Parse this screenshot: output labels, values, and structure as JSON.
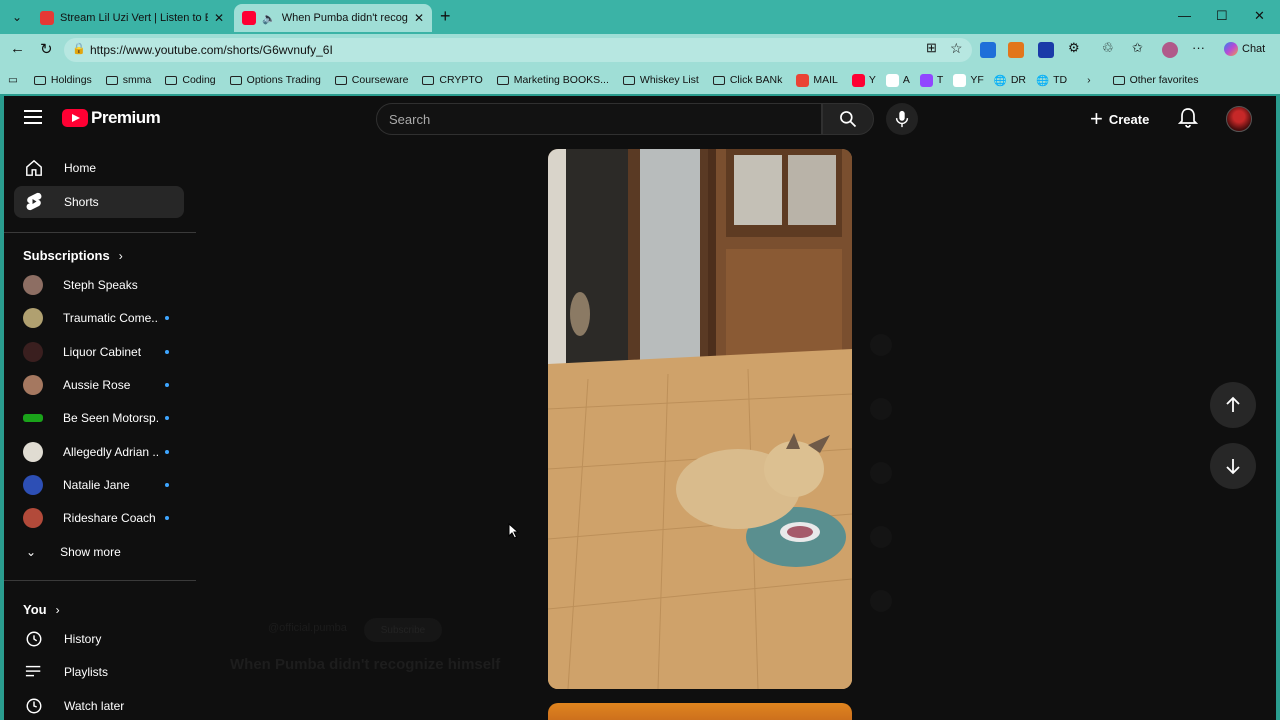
{
  "browser": {
    "tabs": [
      {
        "title": "Stream Lil Uzi Vert | Listen to Etern",
        "active": false
      },
      {
        "title": "When Pumba didn't recogniz",
        "active": true
      }
    ],
    "url": "https://www.youtube.com/shorts/G6wvnufy_6I",
    "chat_label": "Chat",
    "bookmarks": [
      "Holdings",
      "smma",
      "Coding",
      "Options Trading",
      "Courseware",
      "CRYPTO",
      "Marketing BOOKS...",
      "Whiskey List",
      "Click BANk",
      "MAIL",
      "Y",
      "A",
      "T",
      "YF",
      "DR",
      "TD",
      "Other favorites"
    ],
    "colors": {
      "chrome": "#3bb3a6",
      "toolbar": "#9fded6"
    }
  },
  "youtube": {
    "logo_text": "Premium",
    "search_placeholder": "Search",
    "create_label": "Create",
    "sidebar": {
      "main": [
        {
          "label": "Home",
          "icon": "home-icon"
        },
        {
          "label": "Shorts",
          "icon": "shorts-icon",
          "active": true
        }
      ],
      "subscriptions_heading": "Subscriptions",
      "subscriptions": [
        {
          "name": "Steph Speaks",
          "new": false,
          "color": "#8d6e63"
        },
        {
          "name": "Traumatic Come...",
          "new": true,
          "color": "#b0a070"
        },
        {
          "name": "Liquor Cabinet",
          "new": true,
          "color": "#3a1f1f"
        },
        {
          "name": "Aussie Rose",
          "new": true,
          "color": "#a57860"
        },
        {
          "name": "Be Seen Motorsp...",
          "new": true,
          "color": "#1aa31a"
        },
        {
          "name": "Allegedly Adrian ...",
          "new": true,
          "color": "#e0dcd2"
        },
        {
          "name": "Natalie Jane",
          "new": true,
          "color": "#2d4fb5"
        },
        {
          "name": "Rideshare Coach",
          "new": true,
          "color": "#b24a3a"
        }
      ],
      "show_more": "Show more",
      "you_heading": "You",
      "you_items": [
        {
          "label": "History",
          "icon": "history-icon"
        },
        {
          "label": "Playlists",
          "icon": "playlists-icon"
        },
        {
          "label": "Watch later",
          "icon": "watch-later-icon"
        }
      ]
    },
    "short": {
      "channel": "@official.pumba",
      "subscribe_label": "Subscribe",
      "title": "When Pumba didn't recognize himself"
    },
    "colors": {
      "brand": "#ff0033",
      "background": "#0f0f0f",
      "new_dot": "#3ea6ff"
    }
  }
}
